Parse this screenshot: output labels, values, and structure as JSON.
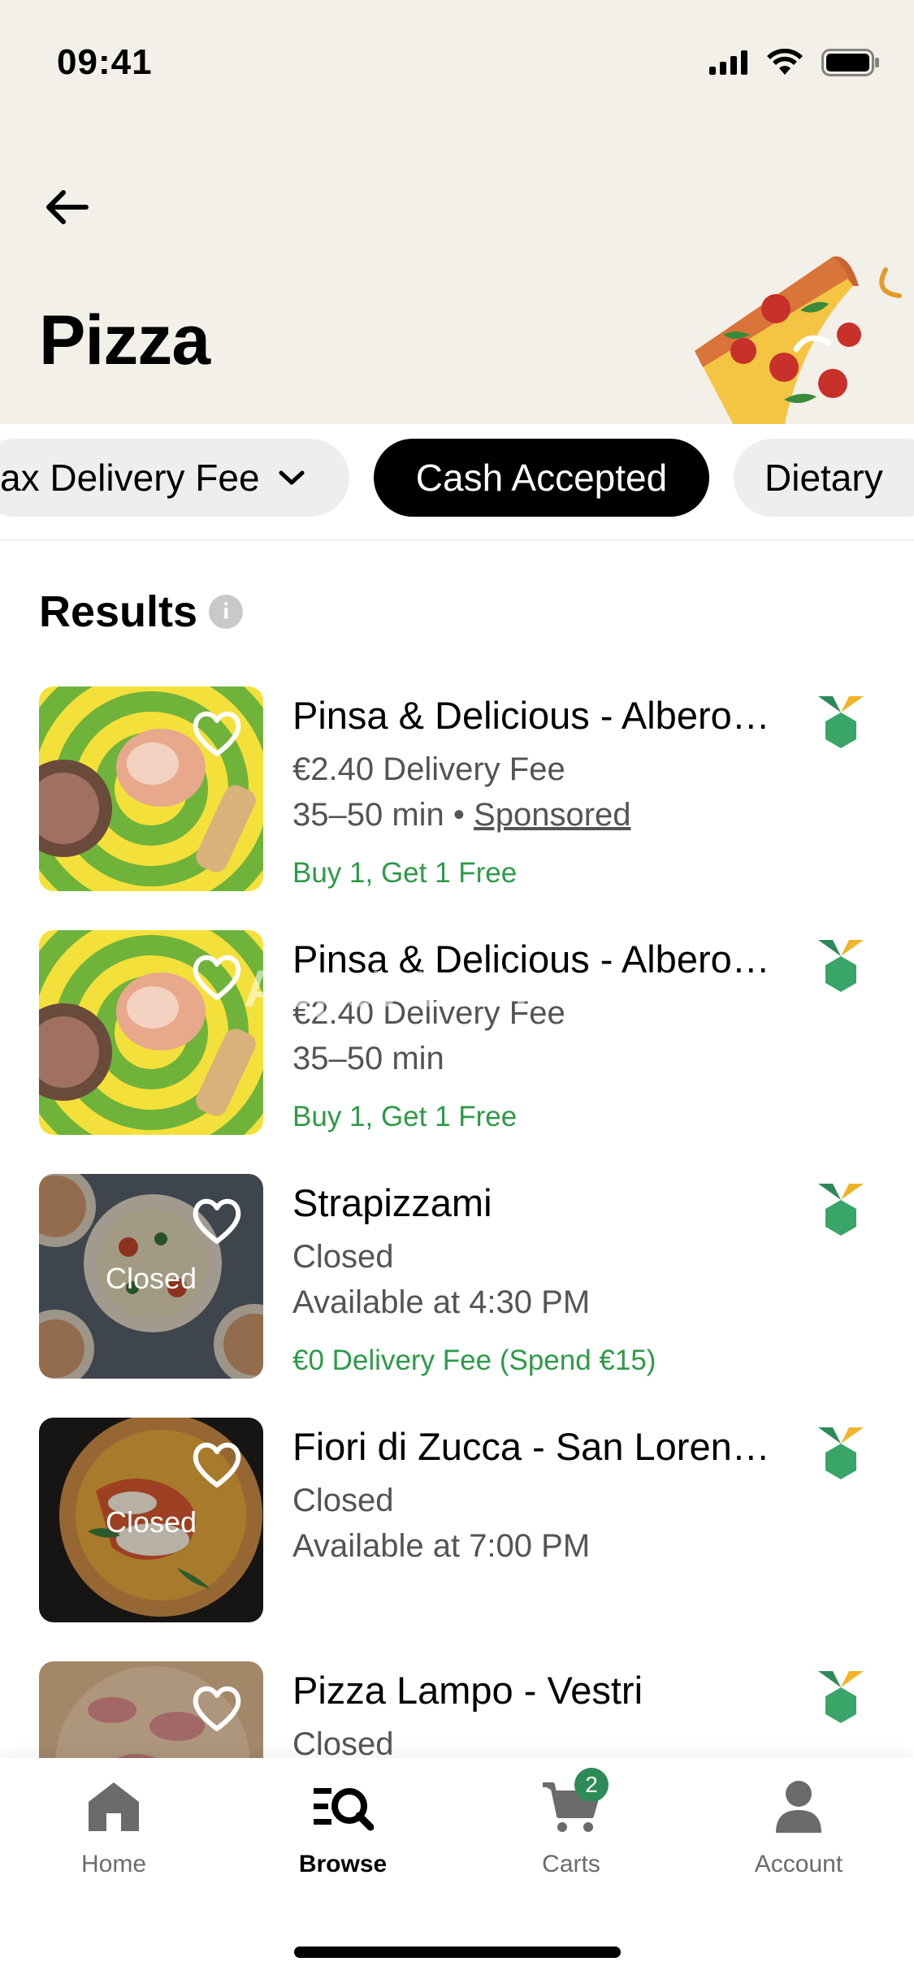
{
  "status_bar": {
    "time": "09:41"
  },
  "header": {
    "title": "Pizza"
  },
  "filters": [
    {
      "label": "ax Delivery Fee",
      "style": "light",
      "has_chevron": true
    },
    {
      "label": "Cash Accepted",
      "style": "dark",
      "has_chevron": false
    },
    {
      "label": "Dietary",
      "style": "light",
      "has_chevron": false
    }
  ],
  "results": {
    "title": "Results",
    "info_icon": "info-icon",
    "items": [
      {
        "name": "Pinsa & Delicious - Albero…",
        "line1": "€2.40 Delivery Fee",
        "line2": "35–50 min",
        "sponsored_sep": " • ",
        "sponsored": "Sponsored",
        "promo": "Buy 1, Get 1 Free",
        "closed": ""
      },
      {
        "name": "Pinsa & Delicious - Albero…",
        "line1": "€2.40 Delivery Fee",
        "line2": "35–50 min",
        "promo": "Buy 1, Get 1 Free",
        "closed": ""
      },
      {
        "name": "Strapizzami",
        "line1": "Closed",
        "line2": "Available at 4:30 PM",
        "promo": "€0 Delivery Fee (Spend €15)",
        "closed": "Closed"
      },
      {
        "name": "Fiori di Zucca - San Loren…",
        "line1": "Closed",
        "line2": "Available at 7:00 PM",
        "promo": "",
        "closed": "Closed"
      },
      {
        "name": "Pizza Lampo - Vestri",
        "line1": "Closed",
        "line2": "",
        "promo": "",
        "closed": ""
      }
    ]
  },
  "watermark": "AppsWatcher.com",
  "tabbar": {
    "tabs": [
      {
        "label": "Home",
        "icon": "home-icon"
      },
      {
        "label": "Browse",
        "icon": "browse-icon",
        "active": true
      },
      {
        "label": "Carts",
        "icon": "cart-icon",
        "badge": "2"
      },
      {
        "label": "Account",
        "icon": "account-icon"
      }
    ]
  },
  "colors": {
    "header_bg": "#f3efe9",
    "promo_green": "#2e9a48",
    "chip_dark": "#000000",
    "chip_light": "#eeeeee"
  }
}
